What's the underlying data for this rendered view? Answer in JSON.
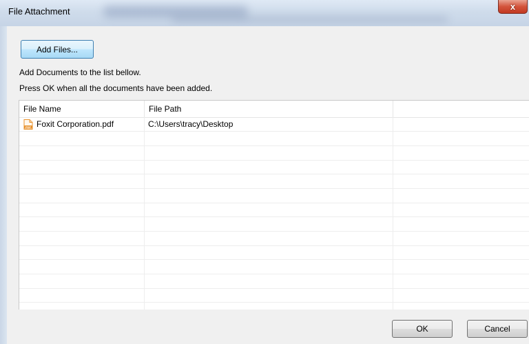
{
  "window": {
    "title": "File Attachment",
    "close_label": "x"
  },
  "toolbar": {
    "add_files_label": "Add Files..."
  },
  "instructions": {
    "line1": "Add Documents to the list bellow.",
    "line2": "Press OK when all the documents have been added."
  },
  "file_list": {
    "columns": [
      "File Name",
      "File Path",
      ""
    ],
    "rows": [
      {
        "icon": "pdf-file-icon",
        "name": "Foxit Corporation.pdf",
        "path": "C:\\Users\\tracy\\Desktop"
      }
    ]
  },
  "footer": {
    "ok_label": "OK",
    "cancel_label": "Cancel"
  },
  "colors": {
    "pdf_icon": "#e8922e",
    "close_button": "#c8452d",
    "add_button_border": "#3c7fb1"
  }
}
